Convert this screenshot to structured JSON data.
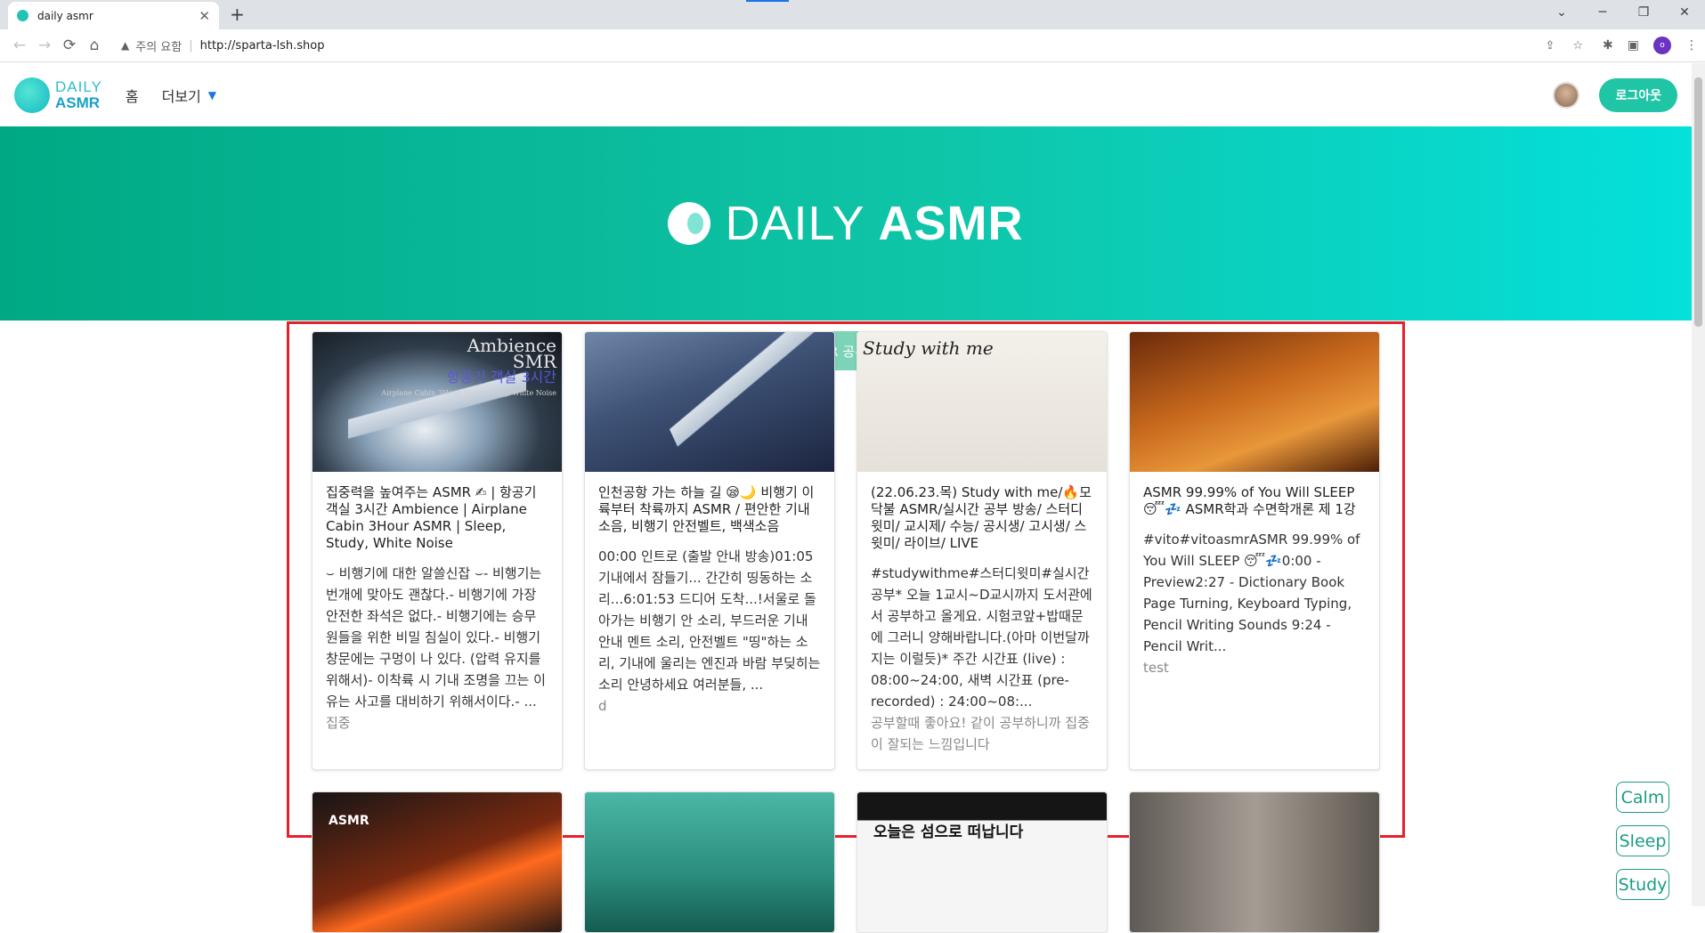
{
  "browser": {
    "tab_title": "daily asmr",
    "tab_close": "✕",
    "new_tab": "+",
    "security_label": "주의 요함",
    "url": "http://sparta-lsh.shop",
    "profile_initial": "o",
    "window_controls": [
      "⌄",
      "─",
      "❐",
      "✕"
    ]
  },
  "nav": {
    "logo_line1": "DAILY",
    "logo_line2": "ASMR",
    "home": "홈",
    "more": "더보기",
    "logout": "로그아웃"
  },
  "hero": {
    "title_light": "DAILY ",
    "title_bold": "ASMR"
  },
  "share_button": "ASMR 공유하기",
  "cards": [
    {
      "thumb_text": "Ambience\nSMR",
      "thumb_sub": "항공기 객실 3시간",
      "thumb_tiny": "Airplane Cabin 3Hour Sleep, Study, White Noise",
      "title": "집중력을 높여주는 ASMR ✍ | 항공기 객실 3시간 Ambience | Airplane Cabin 3Hour ASMR | Sleep, Study, White Noise",
      "desc": "⌣ 비행기에 대한 알쓸신잡 ⌣- 비행기는 번개에 맞아도 괜찮다.- 비행기에 가장 안전한 좌석은 없다.- 비행기에는 승무원들을 위한 비밀 침실이 있다.- 비행기 창문에는 구멍이 나 있다. (압력 유지를 위해서)- 이착륙 시 기내 조명을 끄는 이유는 사고를 대비하기 위해서이다.- ...",
      "comment": "집중"
    },
    {
      "title": "인천공항 가는 하늘 길 😪🌙 비행기 이륙부터 착륙까지 ASMR / 편안한 기내 소음, 비행기 안전벨트, 백색소음",
      "desc": "00:00 인트로 (출발 안내 방송)01:05 기내에서 잠들기... 간간히 띵동하는 소리...6:01:53 드디어 도착...!서울로 돌아가는 비행기 안 소리, 부드러운 기내 안내 멘트 소리, 안전벨트 \"띵\"하는 소리, 기내에 울리는 엔진과 바람 부딪히는 소리 안녕하세요 여러분들, ...",
      "comment": "d"
    },
    {
      "thumb_text": "Study with me",
      "title": "(22.06.23.목) Study with me/🔥모닥불 ASMR/실시간 공부 방송/ 스터디윗미/ 교시제/ 수능/ 공시생/ 고시생/ 스윗미/ 라이브/ LIVE",
      "desc": "#studywithme#스터디윗미#실시간공부* 오늘 1교시~D교시까지 도서관에서 공부하고 올게요. 시험코앞+밥때문에 그러니 양해바랍니다.(아마 이번달까지는 이럴듯)* 주간 시간표 (live) : 08:00~24:00, 새벽 시간표 (pre-recorded) : 24:00~08:...",
      "comment": "공부할때 좋아요! 같이 공부하니까 집중이 잘되는 느낌입니다"
    },
    {
      "title": "ASMR 99.99% of You Will SLEEP 😴💤 ASMR학과 수면학개론 제 1강",
      "desc": "#vito#vitoasmrASMR 99.99% of You Will SLEEP 😴💤0:00 - Preview2:27 - Dictionary Book Page Turning, Keyboard Typing, Pencil Writing Sounds 9:24 - Pencil Writ...",
      "comment": "test"
    },
    {
      "thumb_text": "ASMR"
    },
    {},
    {
      "thumb_text": "오늘은 섬으로 떠납니다"
    },
    {}
  ],
  "tags": [
    "Calm",
    "Sleep",
    "Study"
  ],
  "icons": {
    "back": "arrow-left-icon",
    "forward": "arrow-right-icon",
    "reload": "reload-icon",
    "home": "home-icon",
    "warning": "warning-icon",
    "share": "share-icon",
    "bookmark": "star-icon",
    "extensions": "puzzle-icon",
    "sidepanel": "sidepanel-icon",
    "menu": "kebab-icon",
    "dropdown": "chevron-down-icon"
  },
  "colors": {
    "brand": "#1fc5a4",
    "hero_start": "#00a984",
    "hero_end": "#04e0db",
    "share": "#7dd3b6",
    "highlight_outline": "#e8202b",
    "tag": "#1a9d84"
  }
}
